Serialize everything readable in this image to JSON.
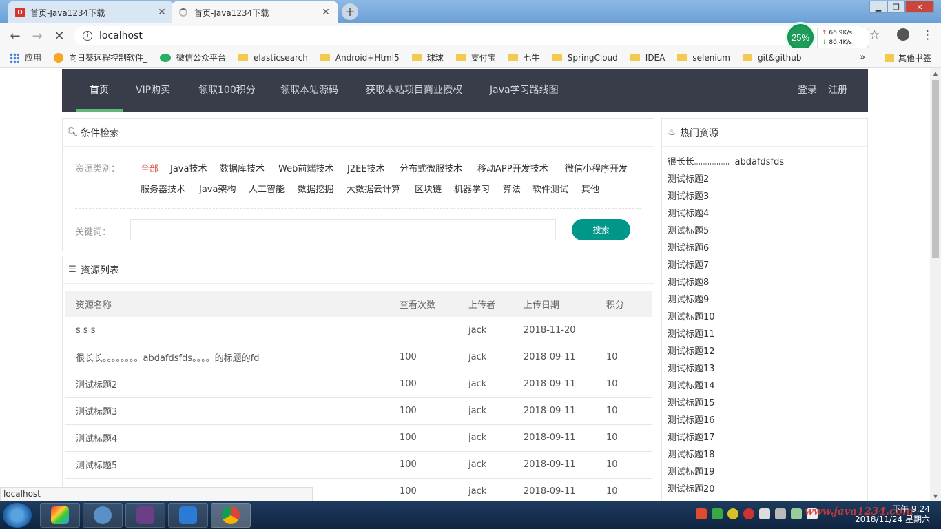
{
  "browser": {
    "tabs": [
      {
        "title": "首页-Java1234下载",
        "favicon": "D"
      },
      {
        "title": "首页-Java1234下载"
      }
    ],
    "url": "localhost",
    "net_monitor": {
      "percent": "25%",
      "up": "66.9K/s",
      "down": "80.4K/s"
    },
    "bookmarks": [
      "应用",
      "向日葵远程控制软件_",
      "微信公众平台",
      "elasticsearch",
      "Android+Html5",
      "球球",
      "支付宝",
      "七牛",
      "SpringCloud",
      "IDEA",
      "selenium",
      "git&github"
    ],
    "bookmarks_more": "»",
    "other_bookmarks": "其他书签",
    "status_url": "localhost"
  },
  "nav": {
    "items": [
      "首页",
      "VIP购买",
      "领取100积分",
      "领取本站源码",
      "获取本站项目商业授权",
      "Java学习路线图"
    ],
    "login": "登录",
    "register": "注册"
  },
  "search": {
    "title": "条件检索",
    "category_label": "资源类别：",
    "categories": [
      "全部",
      "Java技术",
      "数据库技术",
      "Web前端技术",
      "J2EE技术",
      "分布式微服技术",
      "移动APP开发技术",
      "微信小程序开发",
      "服务器技术",
      "Java架构",
      "人工智能",
      "数据挖掘",
      "大数据云计算",
      "区块链",
      "机器学习",
      "算法",
      "软件测试",
      "其他"
    ],
    "keyword_label": "关键词：",
    "keyword_value": "",
    "button": "搜索"
  },
  "list": {
    "title": "资源列表",
    "columns": [
      "资源名称",
      "查看次数",
      "上传者",
      "上传日期",
      "积分"
    ],
    "rows": [
      [
        "s s s",
        "",
        "jack",
        "2018-11-20",
        ""
      ],
      [
        "很长长。。。。。。。。abdafdsfds。。。。的标题的fd",
        "100",
        "jack",
        "2018-09-11",
        "10"
      ],
      [
        "测试标题2",
        "100",
        "jack",
        "2018-09-11",
        "10"
      ],
      [
        "测试标题3",
        "100",
        "jack",
        "2018-09-11",
        "10"
      ],
      [
        "测试标题4",
        "100",
        "jack",
        "2018-09-11",
        "10"
      ],
      [
        "测试标题5",
        "100",
        "jack",
        "2018-09-11",
        "10"
      ],
      [
        "",
        "100",
        "jack",
        "2018-09-11",
        "10"
      ]
    ]
  },
  "hot": {
    "title": "热门资源",
    "items": [
      "很长长。。。。。。。。abdafdsfds",
      "测试标题2",
      "测试标题3",
      "测试标题4",
      "测试标题5",
      "测试标题6",
      "测试标题7",
      "测试标题8",
      "测试标题9",
      "测试标题10",
      "测试标题11",
      "测试标题12",
      "测试标题13",
      "测试标题14",
      "测试标题15",
      "测试标题16",
      "测试标题17",
      "测试标题18",
      "测试标题19",
      "测试标题20"
    ]
  },
  "taskbar": {
    "time": "下午 9:24",
    "date": "2018/11/24 星期六",
    "watermark": "www.java1234.com"
  },
  "colors": {
    "nav_bg": "#393d49",
    "nav_underline": "#5fb878",
    "search_button": "#009688",
    "active_category": "#e04c38"
  }
}
